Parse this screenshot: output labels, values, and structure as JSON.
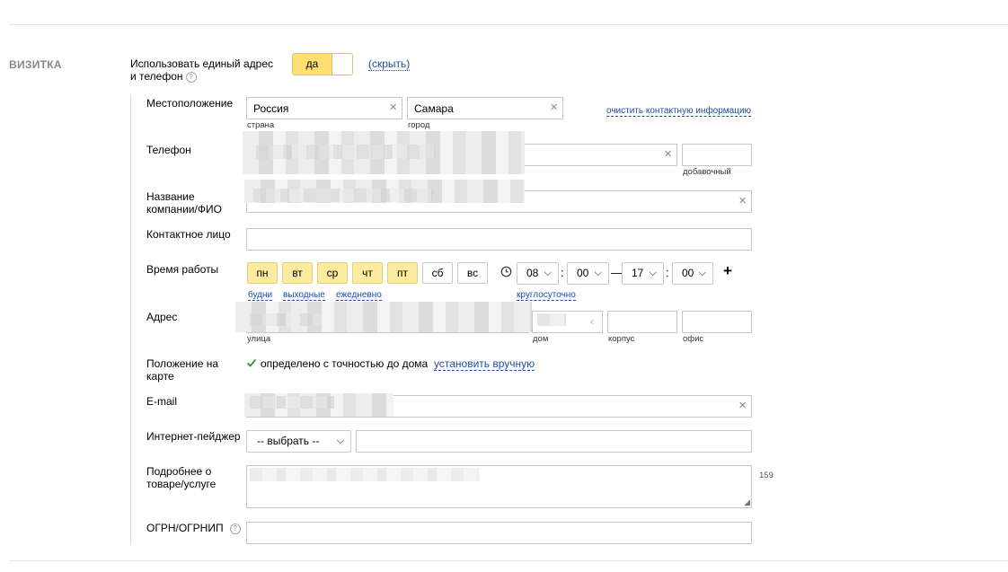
{
  "section": {
    "title": "ВИЗИТКА"
  },
  "unified": {
    "label_line1": "Использовать единый адрес",
    "label_line2": "и телефон",
    "help_icon": "question-circle-icon",
    "toggle_on": "да",
    "hide_link": "(скрыть)"
  },
  "location": {
    "label": "Местоположение",
    "country_value": "Россия",
    "country_caption": "страна",
    "city_value": "Самара",
    "city_caption": "город",
    "clear_link": "очистить контактную информацию"
  },
  "phone": {
    "label": "Телефон",
    "ext_caption": "добавочный"
  },
  "company": {
    "label_line1": "Название",
    "label_line2": "компании/ФИО"
  },
  "contact": {
    "label": "Контактное лицо"
  },
  "hours": {
    "label": "Время работы",
    "days": [
      {
        "label": "пн",
        "active": true
      },
      {
        "label": "вт",
        "active": true
      },
      {
        "label": "ср",
        "active": true
      },
      {
        "label": "чт",
        "active": true
      },
      {
        "label": "пт",
        "active": true
      },
      {
        "label": "сб",
        "active": false
      },
      {
        "label": "вс",
        "active": false
      }
    ],
    "quick_weekdays": "будни",
    "quick_weekend": "выходные",
    "quick_daily": "ежедневно",
    "clock_icon": "clock-icon",
    "from_hour": "08",
    "from_min": "00",
    "dash": "—",
    "to_hour": "17",
    "to_min": "00",
    "colon": ":",
    "around_clock": "круглосуточно",
    "add": "+"
  },
  "address": {
    "label": "Адрес",
    "street_caption": "улица",
    "house_caption": "дом",
    "building_caption": "корпус",
    "office_caption": "офис"
  },
  "map": {
    "label_line1": "Положение на",
    "label_line2": "карте",
    "status": "определено с точностью до дома",
    "set_manual": "установить вручную"
  },
  "email": {
    "label": "E-mail"
  },
  "pager": {
    "label": "Интернет-пейджер",
    "select_value": "-- выбрать --"
  },
  "details": {
    "label_line1": "Подробнее о",
    "label_line2": "товаре/услуге",
    "counter": "159"
  },
  "ogrn": {
    "label": "ОГРН/ОГРНИП"
  },
  "colors": {
    "accent_yellow": "#ffdf70",
    "day_active": "#ffeba0",
    "link_blue": "#1d4ea3",
    "check_green": "#2e9a2e"
  }
}
